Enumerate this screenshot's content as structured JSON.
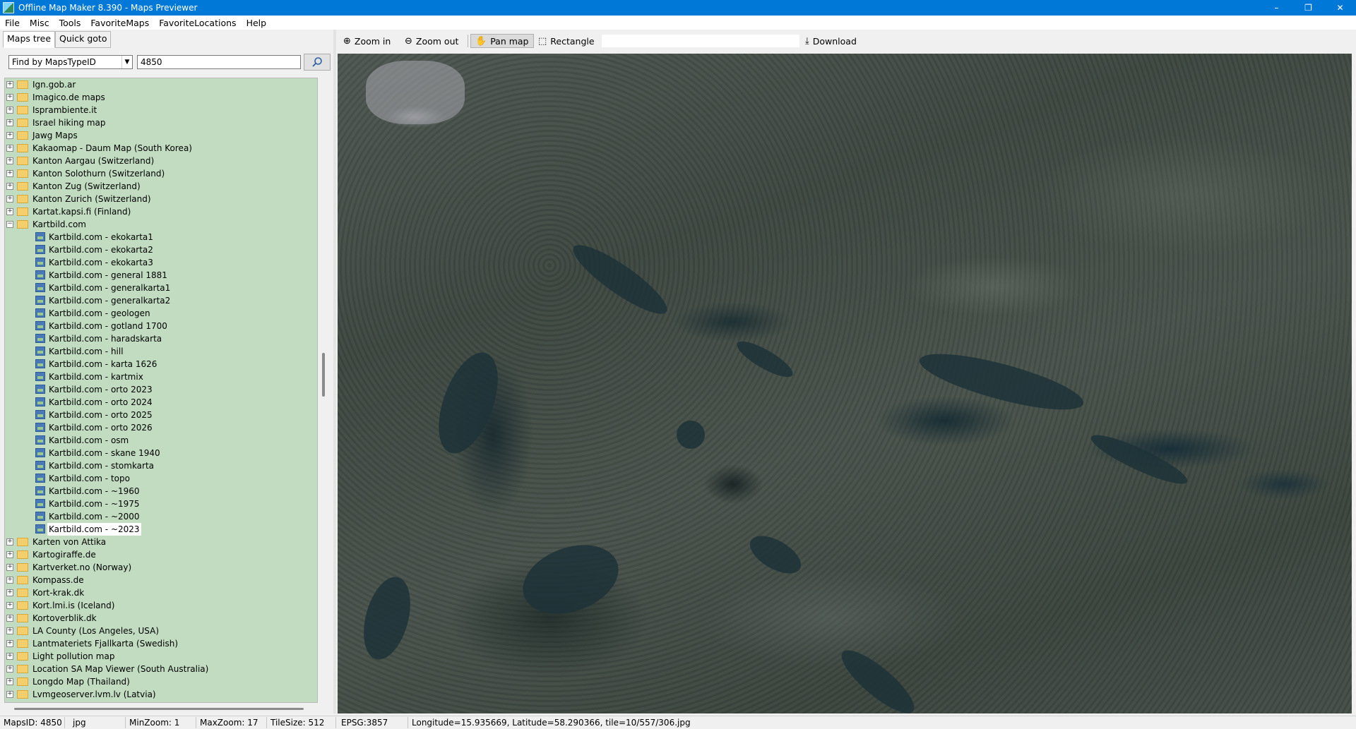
{
  "window": {
    "title": "Offline Map Maker 8.390 - Maps Previewer",
    "controls": [
      "–",
      "❐",
      "✕"
    ]
  },
  "menu": [
    "File",
    "Misc",
    "Tools",
    "FavoriteMaps",
    "FavoriteLocations",
    "Help"
  ],
  "left_panel": {
    "tabs": [
      "Maps tree",
      "Quick goto"
    ],
    "active_tab": "Maps tree",
    "find_select": "Find by MapsTypeID",
    "find_input": "4850",
    "tree": [
      {
        "label": "Ign.gob.ar",
        "type": "folder",
        "expanded": false
      },
      {
        "label": "Imagico.de maps",
        "type": "folder",
        "expanded": false
      },
      {
        "label": "Isprambiente.it",
        "type": "folder",
        "expanded": false
      },
      {
        "label": "Israel hiking map",
        "type": "folder",
        "expanded": false
      },
      {
        "label": "Jawg Maps",
        "type": "folder",
        "expanded": false
      },
      {
        "label": "Kakaomap - Daum Map (South Korea)",
        "type": "folder",
        "expanded": false
      },
      {
        "label": "Kanton Aargau (Switzerland)",
        "type": "folder",
        "expanded": false
      },
      {
        "label": "Kanton Solothurn (Switzerland)",
        "type": "folder",
        "expanded": false
      },
      {
        "label": "Kanton Zug (Switzerland)",
        "type": "folder",
        "expanded": false
      },
      {
        "label": "Kanton Zurich (Switzerland)",
        "type": "folder",
        "expanded": false
      },
      {
        "label": "Kartat.kapsi.fi (Finland)",
        "type": "folder",
        "expanded": false
      },
      {
        "label": "Kartbild.com",
        "type": "folder",
        "expanded": true
      },
      {
        "label": "Kartbild.com - ekokarta1",
        "type": "map"
      },
      {
        "label": "Kartbild.com - ekokarta2",
        "type": "map"
      },
      {
        "label": "Kartbild.com - ekokarta3",
        "type": "map"
      },
      {
        "label": "Kartbild.com - general 1881",
        "type": "map"
      },
      {
        "label": "Kartbild.com - generalkarta1",
        "type": "map"
      },
      {
        "label": "Kartbild.com - generalkarta2",
        "type": "map"
      },
      {
        "label": "Kartbild.com - geologen",
        "type": "map"
      },
      {
        "label": "Kartbild.com - gotland 1700",
        "type": "map"
      },
      {
        "label": "Kartbild.com - haradskarta",
        "type": "map"
      },
      {
        "label": "Kartbild.com - hill",
        "type": "map"
      },
      {
        "label": "Kartbild.com - karta 1626",
        "type": "map"
      },
      {
        "label": "Kartbild.com - kartmix",
        "type": "map"
      },
      {
        "label": "Kartbild.com - orto 2023",
        "type": "map"
      },
      {
        "label": "Kartbild.com - orto 2024",
        "type": "map"
      },
      {
        "label": "Kartbild.com - orto 2025",
        "type": "map"
      },
      {
        "label": "Kartbild.com - orto 2026",
        "type": "map"
      },
      {
        "label": "Kartbild.com - osm",
        "type": "map"
      },
      {
        "label": "Kartbild.com - skane 1940",
        "type": "map"
      },
      {
        "label": "Kartbild.com - stomkarta",
        "type": "map"
      },
      {
        "label": "Kartbild.com - topo",
        "type": "map"
      },
      {
        "label": "Kartbild.com - ~1960",
        "type": "map"
      },
      {
        "label": "Kartbild.com - ~1975",
        "type": "map"
      },
      {
        "label": "Kartbild.com - ~2000",
        "type": "map"
      },
      {
        "label": "Kartbild.com - ~2023",
        "type": "map",
        "selected": true
      },
      {
        "label": "Karten von Attika",
        "type": "folder",
        "expanded": false
      },
      {
        "label": "Kartogiraffe.de",
        "type": "folder",
        "expanded": false
      },
      {
        "label": "Kartverket.no (Norway)",
        "type": "folder",
        "expanded": false
      },
      {
        "label": "Kompass.de",
        "type": "folder",
        "expanded": false
      },
      {
        "label": "Kort-krak.dk",
        "type": "folder",
        "expanded": false
      },
      {
        "label": "Kort.lmi.is (Iceland)",
        "type": "folder",
        "expanded": false
      },
      {
        "label": "Kortoverblik.dk",
        "type": "folder",
        "expanded": false
      },
      {
        "label": "LA County (Los Angeles, USA)",
        "type": "folder",
        "expanded": false
      },
      {
        "label": "Lantmateriets Fjallkarta (Swedish)",
        "type": "folder",
        "expanded": false
      },
      {
        "label": "Light pollution map",
        "type": "folder",
        "expanded": false
      },
      {
        "label": "Location SA Map Viewer (South Australia)",
        "type": "folder",
        "expanded": false
      },
      {
        "label": "Longdo Map (Thailand)",
        "type": "folder",
        "expanded": false
      },
      {
        "label": "Lvmgeoserver.lvm.lv (Latvia)",
        "type": "folder",
        "expanded": false
      }
    ]
  },
  "toolbar": {
    "zoom_in": "Zoom in",
    "zoom_out": "Zoom out",
    "pan_map": "Pan map",
    "rectangle": "Rectangle",
    "download": "Download"
  },
  "status": {
    "maps_id": "MapsID: 4850",
    "format": "jpg",
    "min_zoom": "MinZoom: 1",
    "max_zoom": "MaxZoom: 17",
    "tile_size": "TileSize: 512",
    "epsg": "EPSG:3857",
    "coords": "Longitude=15.935669, Latitude=58.290366, tile=10/557/306.jpg"
  }
}
